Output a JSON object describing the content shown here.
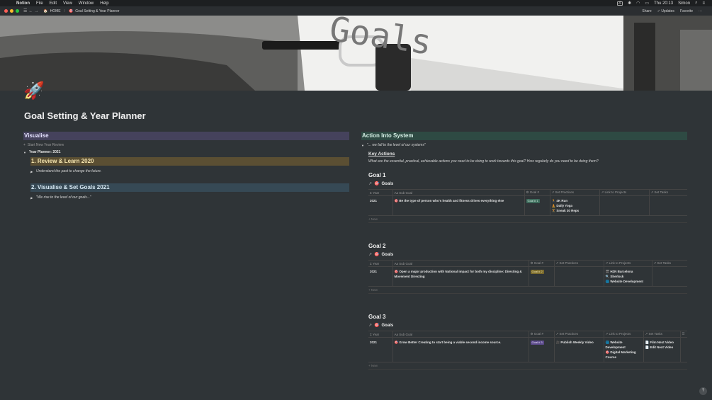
{
  "menubar": {
    "app": "Notion",
    "items": [
      "File",
      "Edit",
      "View",
      "Window",
      "Help"
    ],
    "clock": "Thu 20:13",
    "user": "Simon"
  },
  "topbar": {
    "crumb_home": "HOME",
    "crumb_page": "Goal Setting & Year Planner",
    "share": "Share",
    "updates": "Updates",
    "favorite": "Favorite"
  },
  "cover": {
    "word": "Goals"
  },
  "page": {
    "icon": "🚀",
    "title": "Goal Setting & Year Planner"
  },
  "left": {
    "visualise": "Visualise",
    "start_review": "Start New Year Review",
    "year_planner": "Year Planner: 2021",
    "review_heading": "1. Review & Learn 2020",
    "review_quote": "Understand the past to change the future.",
    "visualise_heading": "2. Visualise & Set Goals 2021",
    "visualise_quote": "\"We rise to the level of our goals...\""
  },
  "right": {
    "heading": "Action Into System",
    "quote": "\"... we fall to the level of our systems\"",
    "key_actions": "Key Actions",
    "key_actions_desc": "What are the essential, practical, achievable actions you need to be doing to work towards this goal? How regularly do you need to be doing them?",
    "new_label": "+ New",
    "db_title": "Goals",
    "columns": {
      "year": "Year",
      "sub_goal": "Sub Goal",
      "goal_num": "Goal #",
      "set_practices": "Set Practices",
      "link_projects": "Link to Projects",
      "set_tasks": "Set Tasks"
    },
    "goal1": {
      "heading": "Goal 1",
      "year": "2021",
      "sub_goal": "Be the type of person who's health and fitness drives everything else",
      "tag": "Goal # 1",
      "practices": [
        "4K Run",
        "Daily Yoga",
        "Sneak 30 Reps"
      ]
    },
    "goal2": {
      "heading": "Goal 2",
      "year": "2021",
      "sub_goal": "Open a major production with National impact for both my discipline: Directing & Movement Directing",
      "tag": "Goal # 2",
      "projects": [
        "H2N Barcelona",
        "Sherlock",
        "Website Development"
      ]
    },
    "goal3": {
      "heading": "Goal 3",
      "year": "2021",
      "sub_goal": "Grow Better Creating to start being a viable second income source.",
      "tag": "Goal # 3",
      "practices": [
        "Publish Weekly Video"
      ],
      "projects": [
        "Website Development",
        "Digital Marketing Course"
      ],
      "tasks": [
        "Film Next Video",
        "Edit Next Video"
      ]
    }
  },
  "colors": {
    "bg": "#2f3437",
    "purple": "#45425c",
    "yellow": "#5b4f33",
    "blue": "#364955",
    "green": "#2e4a43"
  },
  "icons": [
    "apple-icon",
    "rocket-icon",
    "target-icon",
    "arrow-icon",
    "toggle-icon",
    "help-icon"
  ],
  "help": "?"
}
